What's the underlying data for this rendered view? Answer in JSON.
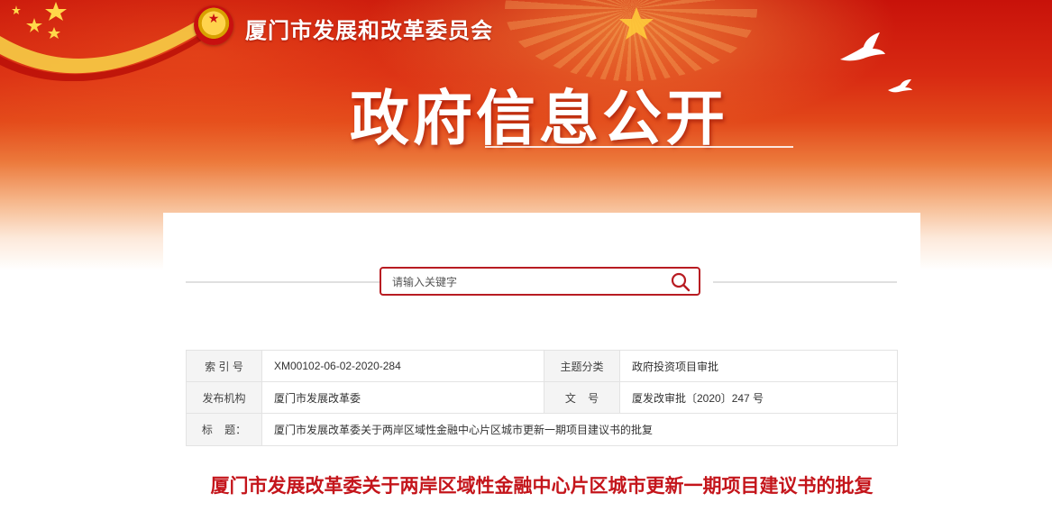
{
  "header": {
    "agency_name": "厦门市发展和改革委员会",
    "banner_title": "政府信息公开"
  },
  "search": {
    "placeholder": "请输入关键字"
  },
  "meta": {
    "index_label": "索 引 号",
    "index_value": "XM00102-06-02-2020-284",
    "category_label": "主题分类",
    "category_value": "政府投资项目审批",
    "publisher_label": "发布机构",
    "publisher_value": "厦门市发展改革委",
    "docno_label": "文    号",
    "docno_value": "厦发改审批〔2020〕247 号",
    "title_label": "标    题：",
    "title_value": "厦门市发展改革委关于两岸区域性金融中心片区城市更新一期项目建议书的批复"
  },
  "document": {
    "title": "厦门市发展改革委关于两岸区域性金融中心片区城市更新一期项目建议书的批复"
  },
  "colors": {
    "brand_red": "#c4151b",
    "banner_red": "#d82a12",
    "search_border": "#b81c22"
  }
}
